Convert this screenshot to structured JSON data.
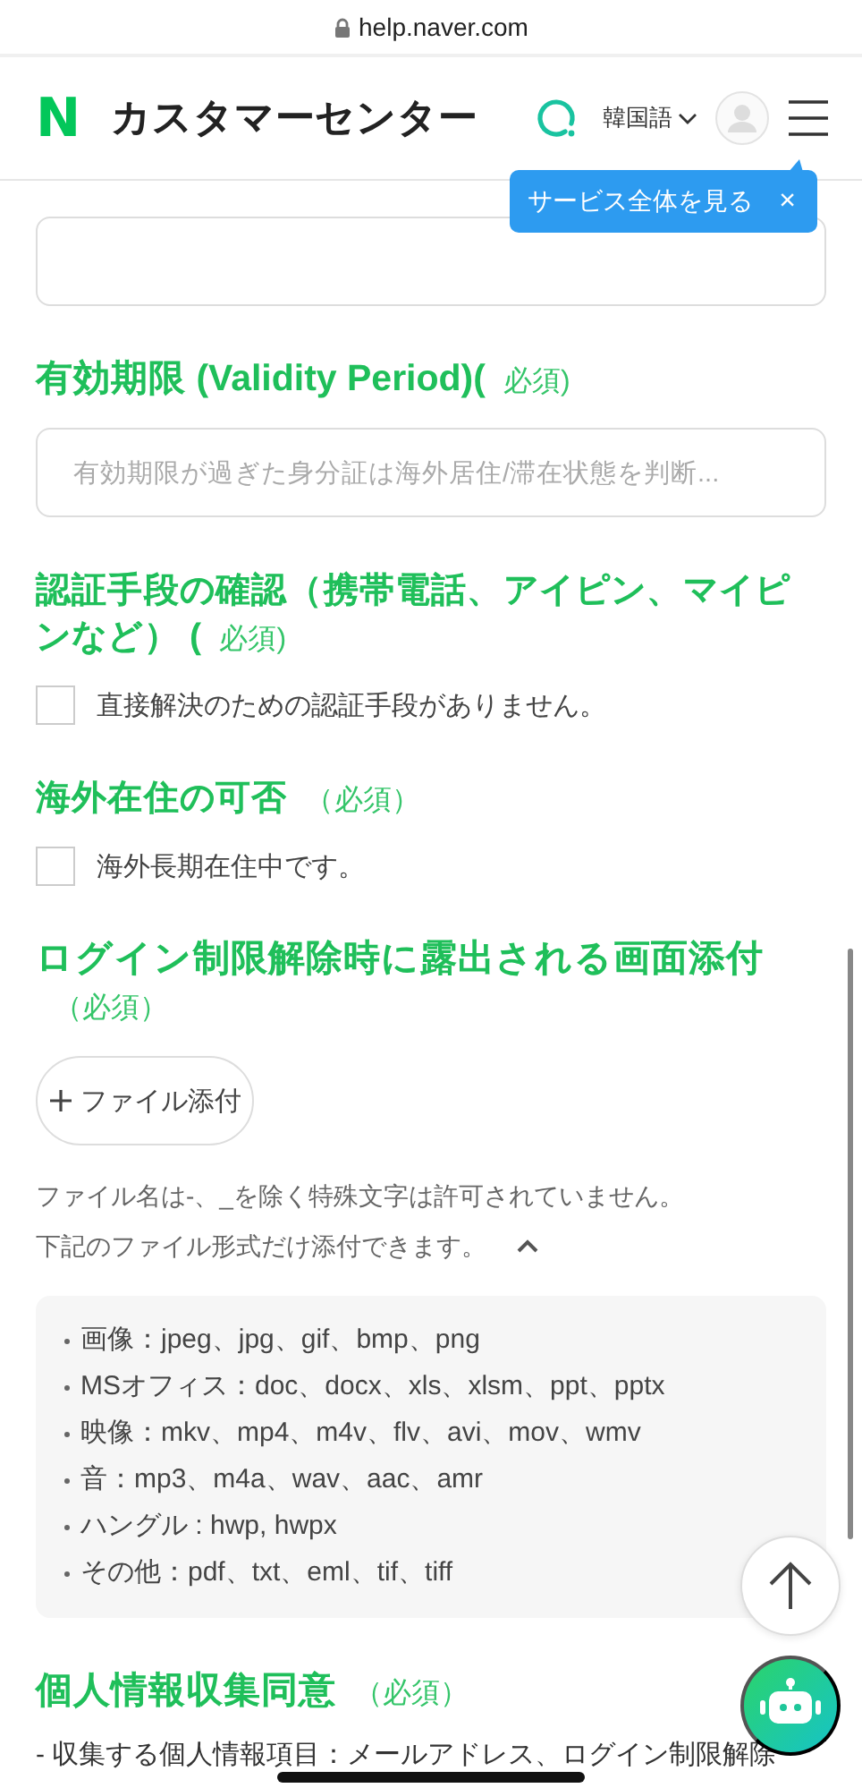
{
  "status_bar": {
    "url": "help.naver.com"
  },
  "header": {
    "logo": "N",
    "title": "カスタマーセンター",
    "language": "韓国語"
  },
  "tooltip": {
    "text": "サービス全体を見る",
    "close": "×"
  },
  "sections": [
    {
      "kind": "field"
    },
    {
      "kind": "field",
      "title": "有効期限 (Validity Period)(",
      "required": "必須)",
      "placeholder": "有効期限が過ぎた身分証は海外居住/滞在状態を判断..."
    },
    {
      "kind": "checkbox",
      "title": "認証手段の確認（携帯電話、アイピン、マイピンなど） (",
      "required": "必須)",
      "option": "直接解決のための認証手段がありません。",
      "checked": false
    },
    {
      "kind": "checkbox",
      "title": "海外在住の可否",
      "required": "（必須）",
      "option": "海外長期在住中です。",
      "checked": false
    },
    {
      "kind": "file",
      "title": "ログイン制限解除時に露出される画面添付",
      "required": "（必須）",
      "button": "ファイル添付",
      "notes": [
        "ファイル名は-、_を除く特殊文字は許可されていません。",
        "下記のファイル形式だけ添付できます。"
      ],
      "expanded": true,
      "formats": [
        "画像：jpeg、jpg、gif、bmp、png",
        "MSオフィス：doc、docx、xls、xlsm、ppt、pptx",
        "映像：mkv、mp4、m4v、flv、avi、mov、wmv",
        "音：mp3、m4a、wav、aac、amr",
        "ハングル : hwp, hwpx",
        "その他：pdf、txt、eml、tif、tiff"
      ]
    },
    {
      "kind": "text",
      "title": "個人情報収集同意",
      "required": "（必須）",
      "text": "- 収集する個人情報項目：メールアドレス、ログイン制限解除"
    }
  ]
}
